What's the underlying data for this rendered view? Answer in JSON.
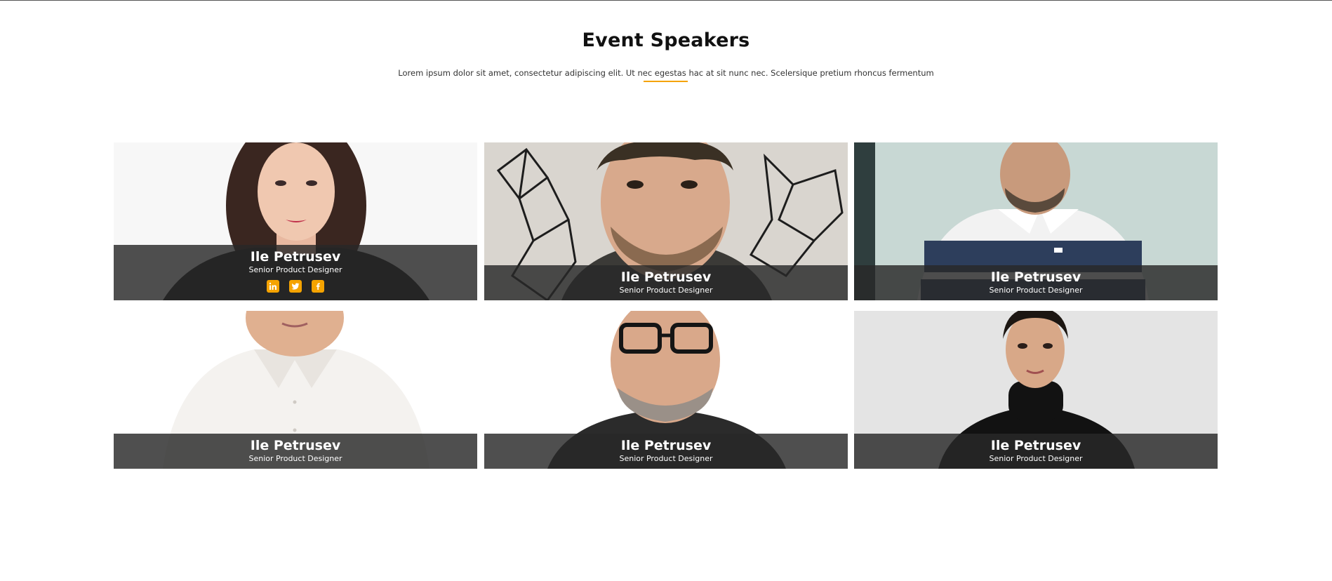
{
  "section": {
    "title": "Event Speakers",
    "subtitle": "Lorem ipsum dolor sit amet, consectetur adipiscing elit. Ut nec egestas hac at sit nunc nec. Scelersique pretium rhoncus fermentum",
    "accent_color": "#f5a300"
  },
  "speakers": [
    {
      "name": "Ile Petrusev",
      "role": "Senior Product Designer",
      "social_icons": [
        "linkedin-icon",
        "twitter-icon",
        "facebook-icon"
      ]
    },
    {
      "name": "Ile Petrusev",
      "role": "Senior Product Designer"
    },
    {
      "name": "Ile Petrusev",
      "role": "Senior Product Designer"
    },
    {
      "name": "Ile Petrusev",
      "role": "Senior Product Designer"
    },
    {
      "name": "Ile Petrusev",
      "role": "Senior Product Designer"
    },
    {
      "name": "Ile Petrusev",
      "role": "Senior Product Designer"
    }
  ]
}
